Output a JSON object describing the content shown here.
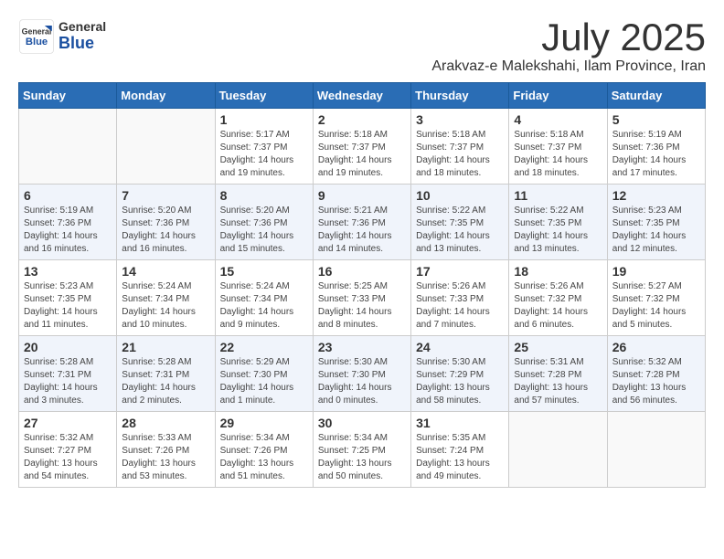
{
  "logo": {
    "general": "General",
    "blue": "Blue"
  },
  "title": "July 2025",
  "location": "Arakvaz-e Malekshahi, Ilam Province, Iran",
  "days_of_week": [
    "Sunday",
    "Monday",
    "Tuesday",
    "Wednesday",
    "Thursday",
    "Friday",
    "Saturday"
  ],
  "weeks": [
    [
      {
        "day": "",
        "info": ""
      },
      {
        "day": "",
        "info": ""
      },
      {
        "day": "1",
        "info": "Sunrise: 5:17 AM\nSunset: 7:37 PM\nDaylight: 14 hours and 19 minutes."
      },
      {
        "day": "2",
        "info": "Sunrise: 5:18 AM\nSunset: 7:37 PM\nDaylight: 14 hours and 19 minutes."
      },
      {
        "day": "3",
        "info": "Sunrise: 5:18 AM\nSunset: 7:37 PM\nDaylight: 14 hours and 18 minutes."
      },
      {
        "day": "4",
        "info": "Sunrise: 5:18 AM\nSunset: 7:37 PM\nDaylight: 14 hours and 18 minutes."
      },
      {
        "day": "5",
        "info": "Sunrise: 5:19 AM\nSunset: 7:36 PM\nDaylight: 14 hours and 17 minutes."
      }
    ],
    [
      {
        "day": "6",
        "info": "Sunrise: 5:19 AM\nSunset: 7:36 PM\nDaylight: 14 hours and 16 minutes."
      },
      {
        "day": "7",
        "info": "Sunrise: 5:20 AM\nSunset: 7:36 PM\nDaylight: 14 hours and 16 minutes."
      },
      {
        "day": "8",
        "info": "Sunrise: 5:20 AM\nSunset: 7:36 PM\nDaylight: 14 hours and 15 minutes."
      },
      {
        "day": "9",
        "info": "Sunrise: 5:21 AM\nSunset: 7:36 PM\nDaylight: 14 hours and 14 minutes."
      },
      {
        "day": "10",
        "info": "Sunrise: 5:22 AM\nSunset: 7:35 PM\nDaylight: 14 hours and 13 minutes."
      },
      {
        "day": "11",
        "info": "Sunrise: 5:22 AM\nSunset: 7:35 PM\nDaylight: 14 hours and 13 minutes."
      },
      {
        "day": "12",
        "info": "Sunrise: 5:23 AM\nSunset: 7:35 PM\nDaylight: 14 hours and 12 minutes."
      }
    ],
    [
      {
        "day": "13",
        "info": "Sunrise: 5:23 AM\nSunset: 7:35 PM\nDaylight: 14 hours and 11 minutes."
      },
      {
        "day": "14",
        "info": "Sunrise: 5:24 AM\nSunset: 7:34 PM\nDaylight: 14 hours and 10 minutes."
      },
      {
        "day": "15",
        "info": "Sunrise: 5:24 AM\nSunset: 7:34 PM\nDaylight: 14 hours and 9 minutes."
      },
      {
        "day": "16",
        "info": "Sunrise: 5:25 AM\nSunset: 7:33 PM\nDaylight: 14 hours and 8 minutes."
      },
      {
        "day": "17",
        "info": "Sunrise: 5:26 AM\nSunset: 7:33 PM\nDaylight: 14 hours and 7 minutes."
      },
      {
        "day": "18",
        "info": "Sunrise: 5:26 AM\nSunset: 7:32 PM\nDaylight: 14 hours and 6 minutes."
      },
      {
        "day": "19",
        "info": "Sunrise: 5:27 AM\nSunset: 7:32 PM\nDaylight: 14 hours and 5 minutes."
      }
    ],
    [
      {
        "day": "20",
        "info": "Sunrise: 5:28 AM\nSunset: 7:31 PM\nDaylight: 14 hours and 3 minutes."
      },
      {
        "day": "21",
        "info": "Sunrise: 5:28 AM\nSunset: 7:31 PM\nDaylight: 14 hours and 2 minutes."
      },
      {
        "day": "22",
        "info": "Sunrise: 5:29 AM\nSunset: 7:30 PM\nDaylight: 14 hours and 1 minute."
      },
      {
        "day": "23",
        "info": "Sunrise: 5:30 AM\nSunset: 7:30 PM\nDaylight: 14 hours and 0 minutes."
      },
      {
        "day": "24",
        "info": "Sunrise: 5:30 AM\nSunset: 7:29 PM\nDaylight: 13 hours and 58 minutes."
      },
      {
        "day": "25",
        "info": "Sunrise: 5:31 AM\nSunset: 7:28 PM\nDaylight: 13 hours and 57 minutes."
      },
      {
        "day": "26",
        "info": "Sunrise: 5:32 AM\nSunset: 7:28 PM\nDaylight: 13 hours and 56 minutes."
      }
    ],
    [
      {
        "day": "27",
        "info": "Sunrise: 5:32 AM\nSunset: 7:27 PM\nDaylight: 13 hours and 54 minutes."
      },
      {
        "day": "28",
        "info": "Sunrise: 5:33 AM\nSunset: 7:26 PM\nDaylight: 13 hours and 53 minutes."
      },
      {
        "day": "29",
        "info": "Sunrise: 5:34 AM\nSunset: 7:26 PM\nDaylight: 13 hours and 51 minutes."
      },
      {
        "day": "30",
        "info": "Sunrise: 5:34 AM\nSunset: 7:25 PM\nDaylight: 13 hours and 50 minutes."
      },
      {
        "day": "31",
        "info": "Sunrise: 5:35 AM\nSunset: 7:24 PM\nDaylight: 13 hours and 49 minutes."
      },
      {
        "day": "",
        "info": ""
      },
      {
        "day": "",
        "info": ""
      }
    ]
  ]
}
